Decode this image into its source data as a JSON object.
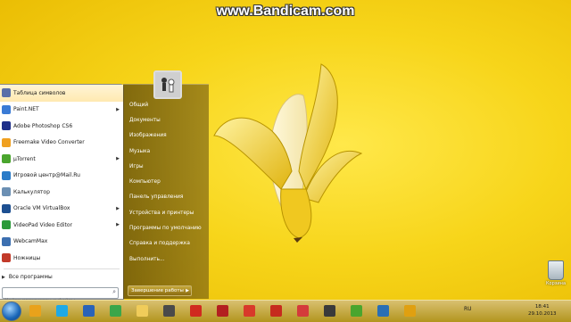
{
  "watermark": "www.Bandicam.com",
  "desktop": {
    "recycle_bin_label": "Корзина"
  },
  "start_menu": {
    "programs": [
      {
        "label": "Таблица символов",
        "color": "#5a6fa8",
        "submenu": false
      },
      {
        "label": "Paint.NET",
        "color": "#3a7bd5",
        "submenu": true
      },
      {
        "label": "Adobe Photoshop CS6",
        "color": "#1e2f8a",
        "submenu": false
      },
      {
        "label": "Freemake Video Converter",
        "color": "#f0a020",
        "submenu": false
      },
      {
        "label": "µTorrent",
        "color": "#4aa52e",
        "submenu": true
      },
      {
        "label": "Игровой центр@Mail.Ru",
        "color": "#2a7bc8",
        "submenu": false
      },
      {
        "label": "Калькулятор",
        "color": "#6b8fb3",
        "submenu": false
      },
      {
        "label": "Oracle VM VirtualBox",
        "color": "#1d4f91",
        "submenu": true
      },
      {
        "label": "VideoPad Video Editor",
        "color": "#2b9a3a",
        "submenu": true
      },
      {
        "label": "WebcamMax",
        "color": "#3c6fb0",
        "submenu": false
      },
      {
        "label": "Ножницы",
        "color": "#c23a2a",
        "submenu": false
      }
    ],
    "all_programs": "Все программы",
    "search_placeholder": "Найти программы и файлы",
    "right_items": [
      "Общий",
      "Документы",
      "Изображения",
      "Музыка",
      "Игры",
      "Компьютер",
      "Панель управления",
      "Устройства и принтеры",
      "Программы по умолчанию",
      "Справка и поддержка",
      "Выполнить..."
    ],
    "shutdown_label": "Завершение работы"
  },
  "taskbar": {
    "apps": [
      {
        "name": "chrome-canary-icon",
        "color": "#e9a21b"
      },
      {
        "name": "skype-icon",
        "color": "#1fa9e6"
      },
      {
        "name": "app-icon",
        "color": "#2a63b8"
      },
      {
        "name": "chrome-icon",
        "color": "#3aa64a"
      },
      {
        "name": "explorer-icon",
        "color": "#f0cc5a"
      },
      {
        "name": "media-icon",
        "color": "#4a4a4a"
      },
      {
        "name": "record-icon",
        "color": "#d02a1f"
      },
      {
        "name": "flash-icon",
        "color": "#b32020"
      },
      {
        "name": "tool-icon",
        "color": "#d83a2a"
      },
      {
        "name": "filezilla-icon",
        "color": "#c62b1e"
      },
      {
        "name": "pocket-icon",
        "color": "#d43b3b"
      },
      {
        "name": "video-icon",
        "color": "#3a3a3a"
      },
      {
        "name": "utorrent-icon",
        "color": "#4aa52e"
      },
      {
        "name": "monitor-icon",
        "color": "#2a6fb5"
      },
      {
        "name": "winamp-icon",
        "color": "#e0a010"
      }
    ],
    "language": "RU",
    "time": "18:41",
    "date": "29.10.2013"
  }
}
